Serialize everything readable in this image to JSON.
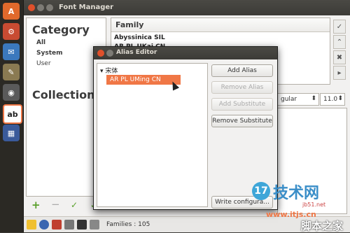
{
  "launcher": {
    "items": [
      {
        "icon": "ubuntu-software-icon",
        "color": "#e0692c",
        "glyph": "A"
      },
      {
        "icon": "settings-wrench-icon",
        "color": "#c84b32",
        "glyph": ""
      },
      {
        "icon": "thunderbird-icon",
        "color": "#3b78bd",
        "glyph": ""
      },
      {
        "icon": "gimp-icon",
        "color": "#8a7a52",
        "glyph": ""
      },
      {
        "icon": "camera-icon",
        "color": "#5a5a5a",
        "glyph": ""
      },
      {
        "icon": "font-manager-icon",
        "color": "#ffffff",
        "glyph": "ab"
      },
      {
        "icon": "workspace-switcher-icon",
        "color": "#3a5a9a",
        "glyph": ""
      }
    ]
  },
  "font_manager": {
    "title": "Font Manager",
    "category_title": "Category",
    "categories": [
      "All",
      "System",
      "User"
    ],
    "collection_title": "Collection",
    "family_header": "Family",
    "families": [
      "Abyssinica SIL",
      "AR PL UKai CN"
    ],
    "style_value": "Regular",
    "style_visible": "gular",
    "size_value": "11.0",
    "families_count": "Families : 105"
  },
  "alias_editor": {
    "title": "Alias Editor",
    "tree_root": "宋体",
    "selected_alias": "AR PL UMing CN",
    "buttons": {
      "add_alias": "Add Alias",
      "remove_alias": "Remove Alias",
      "add_substitute": "Add Substitute",
      "remove_substitute": "Remove Substitute",
      "write_config": "Write configura..."
    }
  },
  "watermark": {
    "brand": "技术网",
    "site1": "www.itjs.cn",
    "site2": "jb51.net",
    "logo_label": "脚本之家"
  },
  "colors": {
    "accent": "#f07746",
    "close": "#e0502b",
    "titlebar": "#3c3b37"
  }
}
